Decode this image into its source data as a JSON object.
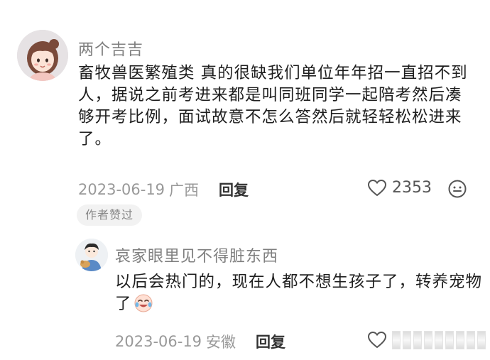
{
  "comment": {
    "username": "两个吉吉",
    "text": "畜牧兽医繁殖类 真的很缺我们单位年年招一直招不到人，据说之前考进来都是叫同班同学一起陪考然后凑够开考比例，面试故意不怎么答然后就轻轻松松进来了。",
    "date": "2023-06-19",
    "location": "广西",
    "reply_label": "回复",
    "like_count": "2353",
    "author_badge": "作者赞过",
    "icons": {
      "like": "heart-outline-icon",
      "emoji": "smiley-face-icon"
    }
  },
  "reply": {
    "username": "哀家眼里见不得脏东西",
    "text": "以后会热门的，现在人都不想生孩子了，转养宠物了",
    "emoji": "crying-laughing-emoji",
    "date": "2023-06-19",
    "location": "安徽",
    "reply_label": "回复",
    "icons": {
      "like": "heart-outline-icon"
    }
  },
  "colors": {
    "text": "#1e1e1e",
    "secondary": "#999999",
    "username": "#7f7f7f"
  }
}
